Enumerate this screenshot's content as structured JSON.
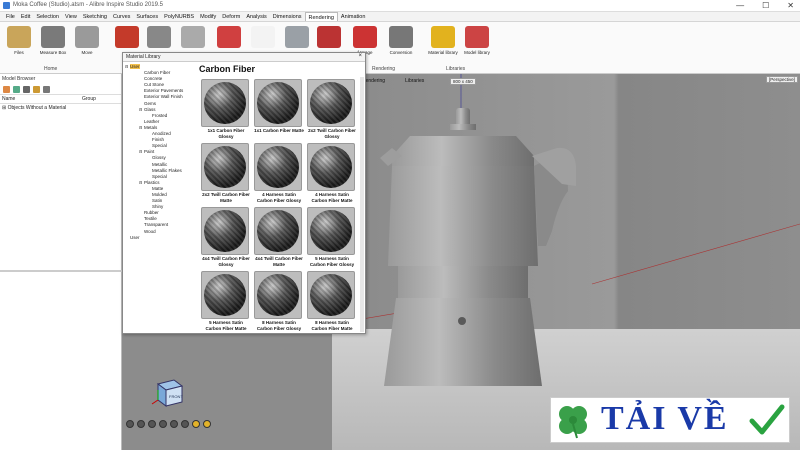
{
  "window": {
    "title": "Moka Coffee (Studio).atsm - Alibre Inspire Studio 2019.5",
    "controls": [
      "—",
      "☐",
      "✕"
    ]
  },
  "menu": [
    "File",
    "Edit",
    "Selection",
    "View",
    "Sketching",
    "Curves",
    "Surfaces",
    "PolyNURBS",
    "Modify",
    "Deform",
    "Analysis",
    "Dimensions",
    "Rendering",
    "Animation"
  ],
  "menu_active": "Rendering",
  "ribbon": {
    "buttons": [
      {
        "name": "files",
        "label": "Files",
        "color": "#c9a55a"
      },
      {
        "name": "measure-box",
        "label": "Measure Box",
        "color": "#7a7a7a"
      },
      {
        "name": "move",
        "label": "Move",
        "color": "#9a9a9a"
      },
      {
        "name": "render-sphere",
        "label": "",
        "color": "#c43a2a"
      },
      {
        "name": "checker",
        "label": "",
        "color": "#888888"
      },
      {
        "name": "env",
        "label": "",
        "color": "#aaaaaa"
      },
      {
        "name": "box",
        "label": "",
        "color": "#d04040"
      },
      {
        "name": "light",
        "label": "",
        "color": "#f3f3f3"
      },
      {
        "name": "cylinder",
        "label": "",
        "color": "#9aa0a6"
      },
      {
        "name": "camera",
        "label": "",
        "color": "#b33"
      },
      {
        "name": "image",
        "label": "f Image",
        "color": "#cc3333"
      },
      {
        "name": "conversion",
        "label": "Conversion",
        "color": "#777777"
      },
      {
        "name": "material-library",
        "label": "Material library",
        "color": "#e2b21e"
      },
      {
        "name": "model-library",
        "label": "Model library",
        "color": "#cc4444"
      }
    ],
    "groups": [
      "Home",
      "Rendering",
      "Libraries"
    ]
  },
  "left_panel": {
    "title": "Model Browser",
    "columns": [
      "Name",
      "Group"
    ],
    "rows": [
      "Objects Without a Material"
    ]
  },
  "material_library": {
    "title": "Material Library",
    "heading": "Carbon Fiber",
    "tree": [
      {
        "label": "User",
        "level": 0,
        "exp": "⊟",
        "selected": true
      },
      {
        "label": "Carbon Fiber",
        "level": 1,
        "exp": ""
      },
      {
        "label": "Concrete",
        "level": 1,
        "exp": ""
      },
      {
        "label": "Cut Stone",
        "level": 1,
        "exp": ""
      },
      {
        "label": "Exterior Pavements",
        "level": 1,
        "exp": ""
      },
      {
        "label": "Exterior Wall Finish",
        "level": 1,
        "exp": ""
      },
      {
        "label": "Gems",
        "level": 1,
        "exp": ""
      },
      {
        "label": "Glass",
        "level": 1,
        "exp": "⊟"
      },
      {
        "label": "Frosted",
        "level": 2,
        "exp": ""
      },
      {
        "label": "Leather",
        "level": 1,
        "exp": ""
      },
      {
        "label": "Metals",
        "level": 1,
        "exp": "⊟"
      },
      {
        "label": "Anodized",
        "level": 2,
        "exp": ""
      },
      {
        "label": "Finish",
        "level": 2,
        "exp": ""
      },
      {
        "label": "Special",
        "level": 2,
        "exp": ""
      },
      {
        "label": "Paint",
        "level": 1,
        "exp": "⊟"
      },
      {
        "label": "Glossy",
        "level": 2,
        "exp": ""
      },
      {
        "label": "Metallic",
        "level": 2,
        "exp": ""
      },
      {
        "label": "Metallic Flakes",
        "level": 2,
        "exp": ""
      },
      {
        "label": "Special",
        "level": 2,
        "exp": ""
      },
      {
        "label": "Plastics",
        "level": 1,
        "exp": "⊟"
      },
      {
        "label": "Matte",
        "level": 2,
        "exp": ""
      },
      {
        "label": "Molded",
        "level": 2,
        "exp": ""
      },
      {
        "label": "Satin",
        "level": 2,
        "exp": ""
      },
      {
        "label": "Shiny",
        "level": 2,
        "exp": ""
      },
      {
        "label": "Rubber",
        "level": 1,
        "exp": ""
      },
      {
        "label": "Textile",
        "level": 1,
        "exp": ""
      },
      {
        "label": "Transparent",
        "level": 1,
        "exp": ""
      },
      {
        "label": "Wood",
        "level": 1,
        "exp": ""
      },
      {
        "label": "User",
        "level": 0,
        "exp": ""
      }
    ],
    "materials": [
      "1x1 Carbon Fiber Glossy",
      "1x1 Carbon Fiber Matte",
      "2x2 Twill Carbon Fiber Glossy",
      "2x2 Twill Carbon Fiber Matte",
      "4 Harness Satin Carbon Fiber Glossy",
      "4 Harness Satin Carbon Fiber Matte",
      "4x4 Twill Carbon Fiber Glossy",
      "4x4 Twill Carbon Fiber Matte",
      "5 Harness Satin Carbon Fiber Glossy",
      "5 Harness Satin Carbon Fiber Matte",
      "8 Harness Satin Carbon Fiber Glossy",
      "8 Harness Satin Carbon Fiber Matte"
    ]
  },
  "viewport": {
    "tabs": [
      "Rendering",
      "Libraries"
    ],
    "size_label": "800 x 450",
    "view_label": "[Perspective]",
    "gizmo_label": "FRONT"
  },
  "watermark": {
    "text": "TẢI VỀ"
  }
}
